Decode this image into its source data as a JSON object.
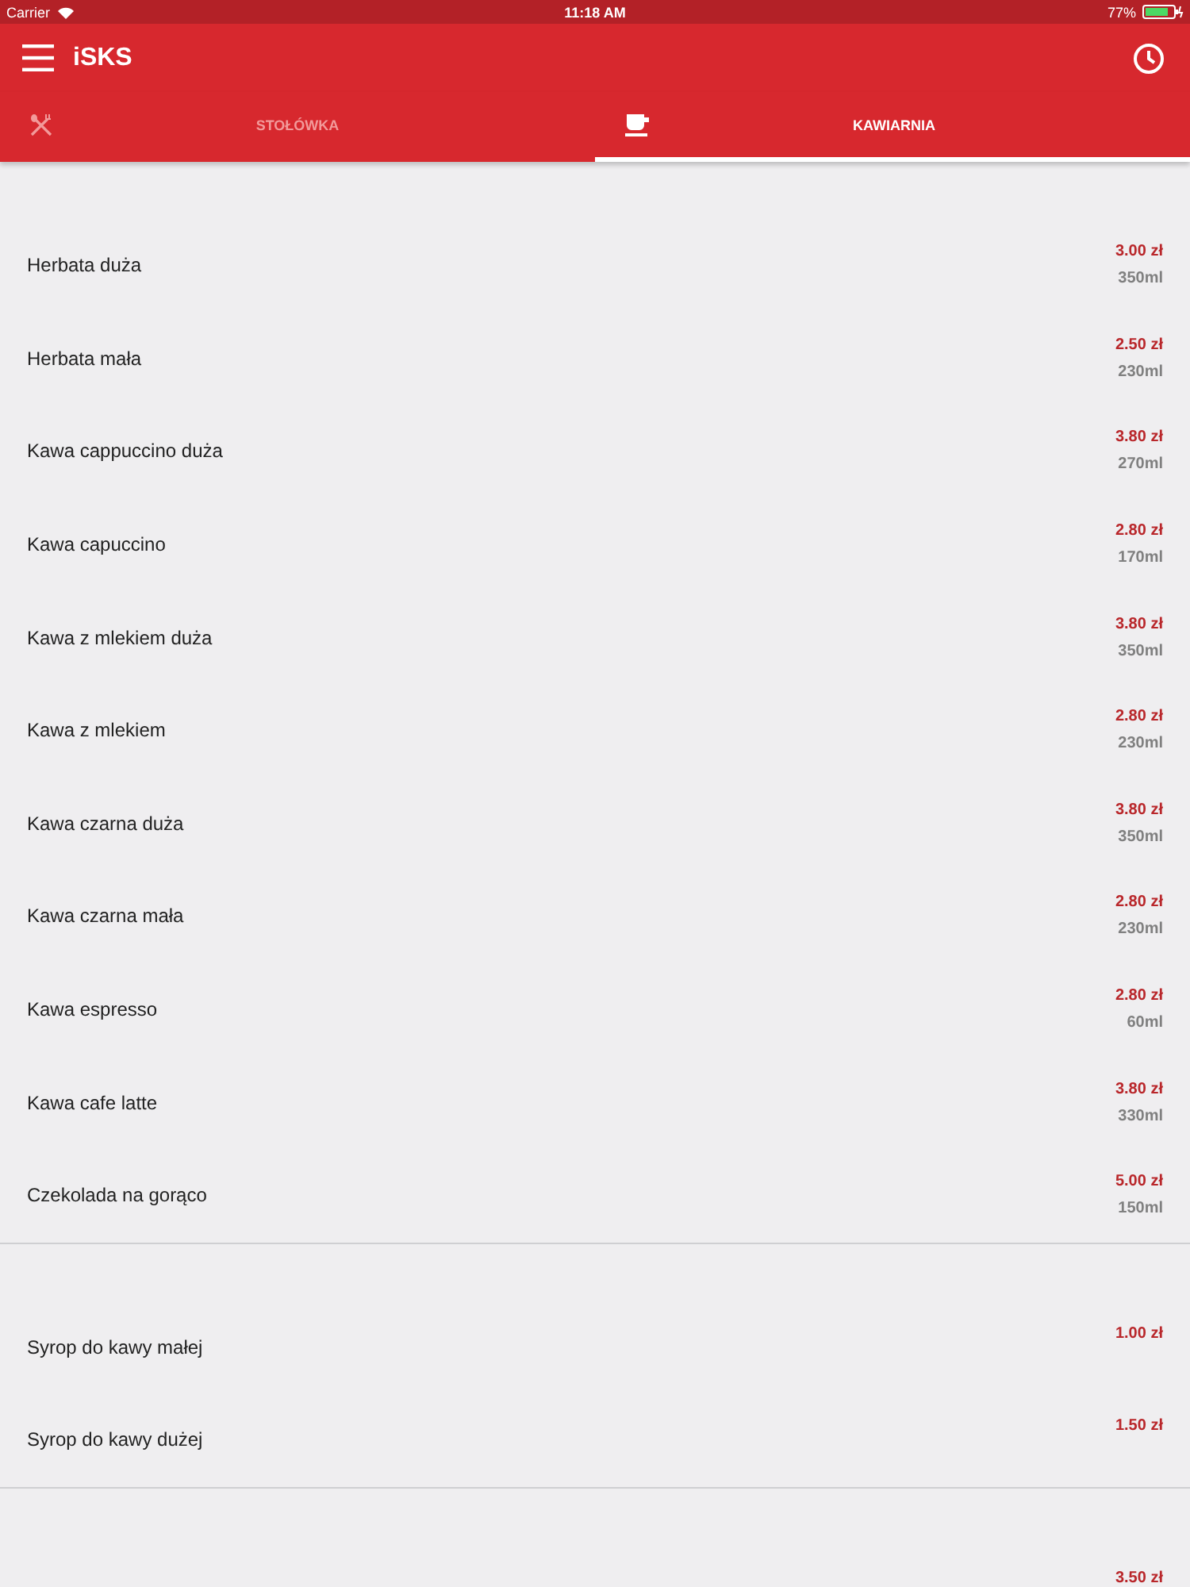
{
  "status_bar": {
    "carrier": "Carrier",
    "time": "11:18 AM",
    "battery": "77%"
  },
  "app_bar": {
    "title": "iSKS"
  },
  "tabs": [
    {
      "label": "STOŁÓWKA",
      "kind": "cutlery",
      "selected": false
    },
    {
      "label": "KAWIARNIA",
      "kind": "cup",
      "selected": true
    }
  ],
  "sections": [
    {
      "items": [
        {
          "name": "Herbata duża",
          "price": "3.00 zł",
          "volume": "350ml"
        },
        {
          "name": "Herbata mała",
          "price": "2.50 zł",
          "volume": "230ml"
        },
        {
          "name": "Kawa cappuccino duża",
          "price": "3.80 zł",
          "volume": "270ml"
        },
        {
          "name": "Kawa capuccino",
          "price": "2.80 zł",
          "volume": "170ml"
        },
        {
          "name": "Kawa z mlekiem duża",
          "price": "3.80 zł",
          "volume": "350ml"
        },
        {
          "name": "Kawa z mlekiem",
          "price": "2.80 zł",
          "volume": "230ml"
        },
        {
          "name": "Kawa czarna duża",
          "price": "3.80 zł",
          "volume": "350ml"
        },
        {
          "name": "Kawa czarna mała",
          "price": "2.80 zł",
          "volume": "230ml"
        },
        {
          "name": "Kawa espresso",
          "price": "2.80 zł",
          "volume": "60ml"
        },
        {
          "name": "Kawa cafe latte",
          "price": "3.80 zł",
          "volume": "330ml"
        },
        {
          "name": "Czekolada na gorąco",
          "price": "5.00 zł",
          "volume": "150ml"
        }
      ]
    },
    {
      "items": [
        {
          "name": "Syrop do kawy małej",
          "price": "1.00 zł"
        },
        {
          "name": "Syrop do kawy dużej",
          "price": "1.50 zł"
        }
      ]
    },
    {
      "items": [
        {
          "price": "3.50 zł"
        }
      ]
    }
  ]
}
